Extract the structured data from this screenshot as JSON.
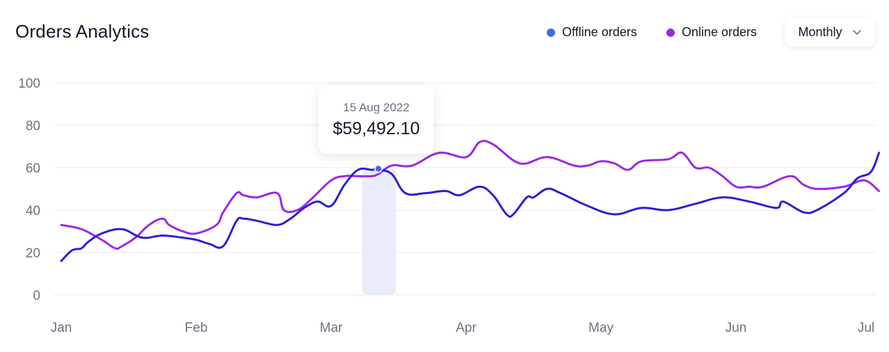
{
  "header": {
    "title": "Orders Analytics",
    "dropdown_label": "Monthly"
  },
  "legend": [
    {
      "label": "Offline orders",
      "color": "#3b6fd8"
    },
    {
      "label": "Online orders",
      "color": "#9b27e6"
    }
  ],
  "tooltip": {
    "date": "15 Aug 2022",
    "value": "$59,492.10"
  },
  "colors": {
    "offline_line": "#2b1ed6",
    "online_line": "#9b27e6",
    "grid": "#e5e7f4",
    "axis_text": "#6b7280",
    "highlight_band": "#e9ecfb"
  },
  "chart_data": {
    "type": "line",
    "title": "Orders Analytics",
    "xlabel": "",
    "ylabel": "",
    "x_ticks": [
      "Jan",
      "Feb",
      "Mar",
      "Apr",
      "May",
      "Jun",
      "Jul"
    ],
    "y_ticks": [
      0,
      20,
      40,
      60,
      80,
      100
    ],
    "xlim": [
      0,
      6.06
    ],
    "ylim": [
      0,
      100
    ],
    "grid": true,
    "legend_position": "top-right",
    "highlight": {
      "x": 2.35,
      "y": 59.5,
      "band": [
        2.23,
        2.48
      ]
    },
    "series": [
      {
        "name": "Offline orders",
        "x": [
          0,
          0.08,
          0.15,
          0.2,
          0.3,
          0.45,
          0.6,
          0.75,
          0.9,
          1.0,
          1.1,
          1.2,
          1.3,
          1.35,
          1.45,
          1.6,
          1.7,
          1.8,
          1.9,
          2.0,
          2.1,
          2.2,
          2.3,
          2.35,
          2.45,
          2.55,
          2.7,
          2.85,
          2.95,
          3.1,
          3.2,
          3.3,
          3.35,
          3.45,
          3.5,
          3.6,
          3.7,
          3.9,
          4.1,
          4.3,
          4.5,
          4.7,
          4.9,
          5.1,
          5.3,
          5.35,
          5.5,
          5.6,
          5.8,
          5.9,
          6.0,
          6.06
        ],
        "values": [
          16,
          21,
          22,
          25,
          29,
          31,
          27,
          28,
          27,
          26,
          24,
          23,
          35,
          36,
          35,
          33,
          36,
          41,
          44,
          42,
          52,
          59,
          59,
          59,
          57,
          48,
          48,
          49,
          47,
          51,
          47,
          38,
          38,
          46,
          46,
          50,
          48,
          42,
          38,
          41,
          40,
          43,
          46,
          44,
          41,
          44,
          39,
          40,
          48,
          55,
          58,
          67
        ]
      },
      {
        "name": "Online orders",
        "x": [
          0,
          0.15,
          0.3,
          0.4,
          0.45,
          0.55,
          0.65,
          0.75,
          0.8,
          0.9,
          1.0,
          1.15,
          1.2,
          1.3,
          1.35,
          1.45,
          1.6,
          1.65,
          1.75,
          1.85,
          2.0,
          2.1,
          2.2,
          2.3,
          2.35,
          2.45,
          2.6,
          2.8,
          3.0,
          3.1,
          3.2,
          3.4,
          3.6,
          3.8,
          3.9,
          4.0,
          4.1,
          4.2,
          4.3,
          4.5,
          4.6,
          4.7,
          4.8,
          4.9,
          5.0,
          5.1,
          5.2,
          5.4,
          5.5,
          5.6,
          5.8,
          5.95,
          6.06
        ],
        "values": [
          33,
          31,
          26,
          22,
          23,
          27,
          33,
          36,
          33,
          30,
          29,
          33,
          39,
          48,
          47,
          46,
          48,
          40,
          40,
          45,
          54,
          56,
          56,
          56,
          57,
          61,
          61,
          67,
          65,
          72,
          71,
          62,
          65,
          61,
          61,
          63,
          62,
          59,
          63,
          64,
          67,
          60,
          60,
          56,
          51,
          51,
          51,
          56,
          52,
          50,
          51,
          54,
          49
        ]
      }
    ]
  }
}
